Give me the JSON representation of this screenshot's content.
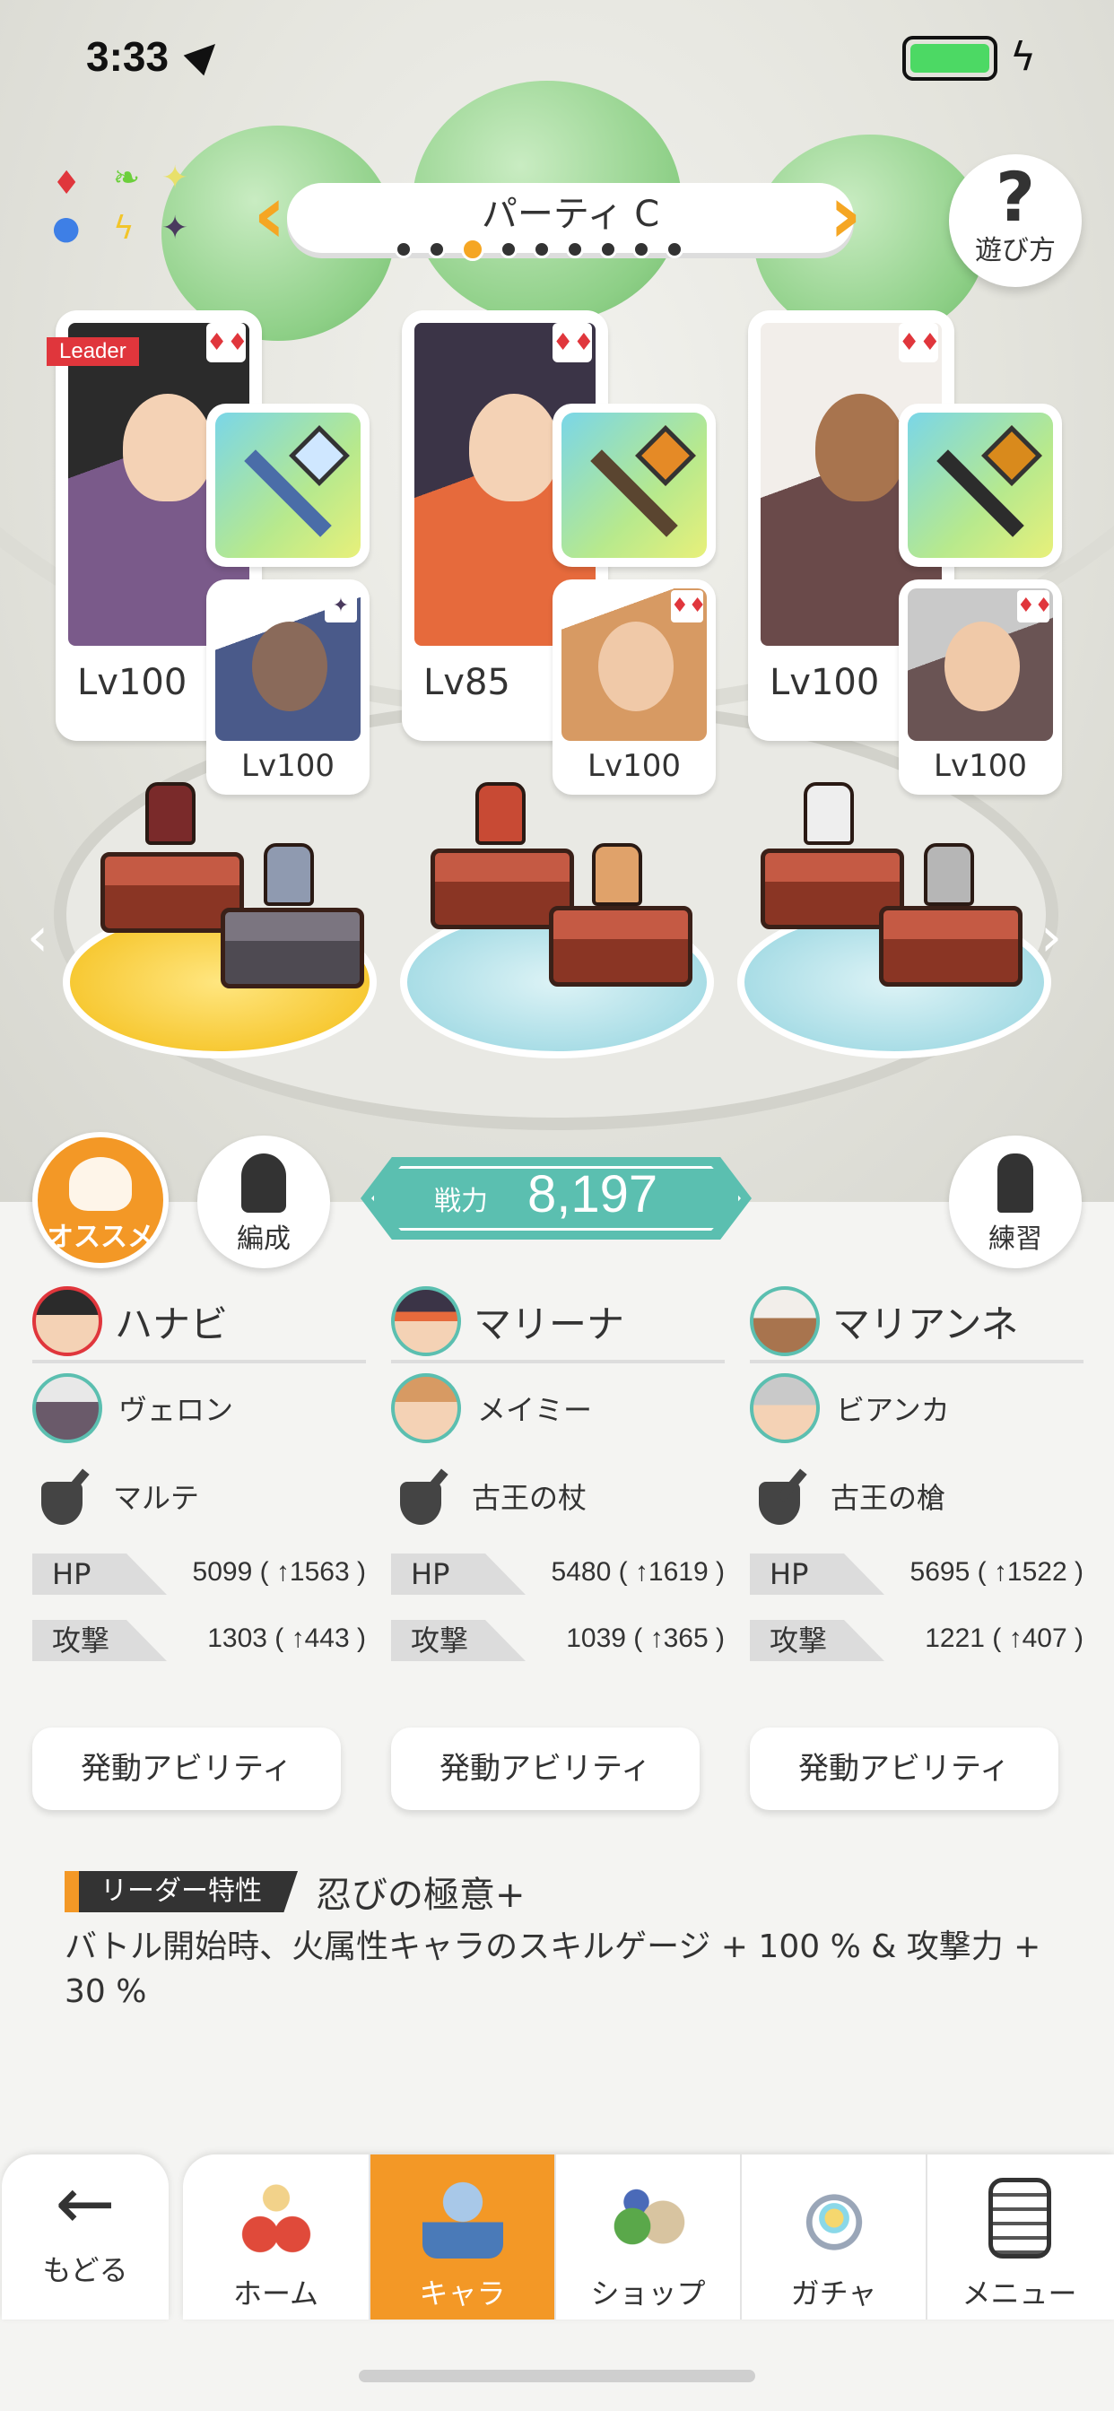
{
  "status_bar": {
    "time": "3:33"
  },
  "party": {
    "title": "パーティ C",
    "page_count": 9,
    "active_page": 3
  },
  "help": {
    "label": "遊び方"
  },
  "slots": [
    {
      "main_level": "Lv100",
      "leader_tag": "Leader",
      "sub_level": "Lv100",
      "main_color": "#5a4668",
      "sub_color": "#4a5a8a"
    },
    {
      "main_level": "Lv85",
      "sub_level": "Lv100",
      "main_color": "#3b3447",
      "sub_color": "#d79a63"
    },
    {
      "main_level": "Lv100",
      "sub_level": "Lv100",
      "main_color": "#e9e3de",
      "sub_color": "#6a5454"
    }
  ],
  "buttons": {
    "recommend": "オススメ",
    "formation": "編成",
    "practice": "練習"
  },
  "power": {
    "label": "戦力",
    "value": "8,197"
  },
  "characters": [
    {
      "name": "ハナビ",
      "sub_name": "ヴェロン",
      "weapon": "マルテ",
      "hp": "5099 ( ↑1563 )",
      "atk": "1303 ( ↑443 )"
    },
    {
      "name": "マリーナ",
      "sub_name": "メイミー",
      "weapon": "古王の杖",
      "hp": "5480 ( ↑1619 )",
      "atk": "1039 ( ↑365 )"
    },
    {
      "name": "マリアンネ",
      "sub_name": "ビアンカ",
      "weapon": "古王の槍",
      "hp": "5695 ( ↑1522 )",
      "atk": "1221 ( ↑407 )"
    }
  ],
  "stat_labels": {
    "hp": "HP",
    "atk": "攻撃"
  },
  "ability_label": "発動アビリティ",
  "leader_trait": {
    "badge": "リーダー特性",
    "name": "忍びの極意+",
    "description": "バトル開始時、火属性キャラのスキルゲージ + 100 % & 攻撃力 + 30 %"
  },
  "nav": {
    "back": "もどる",
    "tabs": [
      {
        "label": "ホーム",
        "icon": "home-icon",
        "active": false
      },
      {
        "label": "キャラ",
        "icon": "character-icon",
        "active": true
      },
      {
        "label": "ショップ",
        "icon": "shop-icon",
        "active": false
      },
      {
        "label": "ガチャ",
        "icon": "gacha-icon",
        "active": false
      },
      {
        "label": "メニュー",
        "icon": "menu-icon",
        "active": false
      }
    ]
  },
  "colors": {
    "accent": "#f39826",
    "teal": "#5bbfb0",
    "suit_red": "#e0363c"
  }
}
